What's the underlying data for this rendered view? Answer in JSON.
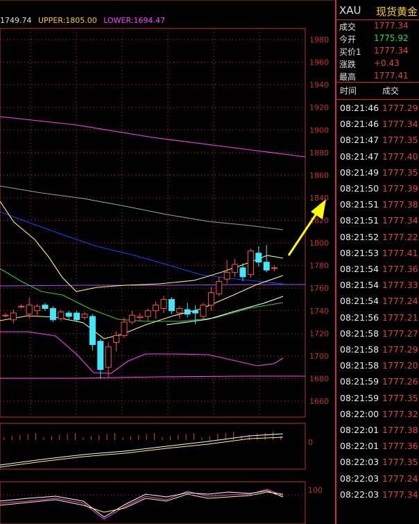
{
  "header": {
    "mid_value": "1749.74",
    "upper": "UPPER:1805.00",
    "lower": "LOWER:1694.47",
    "colors": {
      "mid": "#e0e0e0",
      "upper": "#ffd000",
      "lower": "#ff40ff"
    }
  },
  "chart_data": {
    "type": "line",
    "y_axis_labels": [
      "1980",
      "1960",
      "1940",
      "1920",
      "1900",
      "1880",
      "1860",
      "1840",
      "1820",
      "1800",
      "1780",
      "1760",
      "1740",
      "1720",
      "1700",
      "1680",
      "1660"
    ],
    "ylim": [
      1652,
      1992
    ],
    "macd_label": "0",
    "kdj_label": "100",
    "candles": [
      {
        "o": 1736,
        "c": 1736,
        "h": 1738,
        "l": 1734
      },
      {
        "o": 1732,
        "c": 1738,
        "h": 1741,
        "l": 1729
      },
      {
        "o": 1744,
        "c": 1744,
        "h": 1746,
        "l": 1742
      },
      {
        "o": 1737,
        "c": 1745,
        "h": 1752,
        "l": 1733
      },
      {
        "o": 1740,
        "c": 1744,
        "h": 1746,
        "l": 1736
      },
      {
        "o": 1745,
        "c": 1742,
        "h": 1747,
        "l": 1740
      },
      {
        "o": 1742,
        "c": 1732,
        "h": 1744,
        "l": 1730
      },
      {
        "o": 1733,
        "c": 1739,
        "h": 1741,
        "l": 1731
      },
      {
        "o": 1738,
        "c": 1735,
        "h": 1740,
        "l": 1733
      },
      {
        "o": 1738,
        "c": 1732,
        "h": 1740,
        "l": 1730
      },
      {
        "o": 1734,
        "c": 1737,
        "h": 1739,
        "l": 1732
      },
      {
        "o": 1735,
        "c": 1710,
        "h": 1737,
        "l": 1705
      },
      {
        "o": 1713,
        "c": 1688,
        "h": 1715,
        "l": 1680
      },
      {
        "o": 1690,
        "c": 1708,
        "h": 1712,
        "l": 1681
      },
      {
        "o": 1712,
        "c": 1718,
        "h": 1722,
        "l": 1704
      },
      {
        "o": 1718,
        "c": 1730,
        "h": 1734,
        "l": 1716
      },
      {
        "o": 1730,
        "c": 1736,
        "h": 1740,
        "l": 1728
      },
      {
        "o": 1734,
        "c": 1735,
        "h": 1738,
        "l": 1731
      },
      {
        "o": 1735,
        "c": 1740,
        "h": 1742,
        "l": 1731
      },
      {
        "o": 1740,
        "c": 1745,
        "h": 1748,
        "l": 1733
      },
      {
        "o": 1742,
        "c": 1750,
        "h": 1753,
        "l": 1738
      },
      {
        "o": 1750,
        "c": 1740,
        "h": 1752,
        "l": 1737
      },
      {
        "o": 1738,
        "c": 1742,
        "h": 1744,
        "l": 1733
      },
      {
        "o": 1741,
        "c": 1737,
        "h": 1747,
        "l": 1734
      },
      {
        "o": 1740,
        "c": 1738,
        "h": 1745,
        "l": 1728
      },
      {
        "o": 1735,
        "c": 1745,
        "h": 1747,
        "l": 1733
      },
      {
        "o": 1745,
        "c": 1756,
        "h": 1761,
        "l": 1740
      },
      {
        "o": 1755,
        "c": 1766,
        "h": 1770,
        "l": 1753
      },
      {
        "o": 1768,
        "c": 1774,
        "h": 1785,
        "l": 1764
      },
      {
        "o": 1774,
        "c": 1781,
        "h": 1786,
        "l": 1770
      },
      {
        "o": 1778,
        "c": 1770,
        "h": 1782,
        "l": 1766
      },
      {
        "o": 1772,
        "c": 1793,
        "h": 1795,
        "l": 1769
      },
      {
        "o": 1791,
        "c": 1783,
        "h": 1797,
        "l": 1779
      },
      {
        "o": 1783,
        "c": 1776,
        "h": 1798,
        "l": 1774
      },
      {
        "o": 1778,
        "c": 1778,
        "h": 1780,
        "l": 1775
      }
    ]
  },
  "panel": {
    "symbol": "XAU",
    "name": "现货黄金",
    "quotes": [
      {
        "label": "成交",
        "value": "1777.34",
        "color": "#e04545"
      },
      {
        "label": "今开",
        "value": "1775.92",
        "color": "#30e030"
      },
      {
        "label": "买价1",
        "value": "1777.34",
        "color": "#e04545"
      },
      {
        "label": "涨跌",
        "value": "+0.43",
        "color": "#e04545"
      },
      {
        "label": "最高",
        "value": "1777.41",
        "color": "#e04545"
      }
    ],
    "ticks_header": {
      "time": "时间",
      "price": "成交"
    },
    "ticks": [
      {
        "time": "08:21:46",
        "price": "1777.29"
      },
      {
        "time": "08:21:46",
        "price": "1777.34"
      },
      {
        "time": "08:21:47",
        "price": "1777.35"
      },
      {
        "time": "08:21:47",
        "price": "1777.40"
      },
      {
        "time": "08:21:49",
        "price": "1777.35"
      },
      {
        "time": "08:21:50",
        "price": "1777.39"
      },
      {
        "time": "08:21:51",
        "price": "1777.38"
      },
      {
        "time": "08:21:51",
        "price": "1777.34"
      },
      {
        "time": "08:21:52",
        "price": "1777.22"
      },
      {
        "time": "08:21:53",
        "price": "1777.41"
      },
      {
        "time": "08:21:54",
        "price": "1777.36"
      },
      {
        "time": "08:21:54",
        "price": "1777.33"
      },
      {
        "time": "08:21:54",
        "price": "1777.24"
      },
      {
        "time": "08:21:56",
        "price": "1777.21"
      },
      {
        "time": "08:21:58",
        "price": "1777.27"
      },
      {
        "time": "08:21:58",
        "price": "1777.29"
      },
      {
        "time": "08:21:58",
        "price": "1777.20"
      },
      {
        "time": "08:21:59",
        "price": "1777.26"
      },
      {
        "time": "08:21:59",
        "price": "1777.35"
      },
      {
        "time": "08:22:00",
        "price": "1777.32"
      },
      {
        "time": "08:22:01",
        "price": "1777.38"
      },
      {
        "time": "08:22:01",
        "price": "1777.36"
      },
      {
        "time": "08:22:03",
        "price": "1777.35"
      },
      {
        "time": "08:22:03",
        "price": "1777.24"
      },
      {
        "time": "08:22:03",
        "price": "1777.34"
      }
    ]
  }
}
